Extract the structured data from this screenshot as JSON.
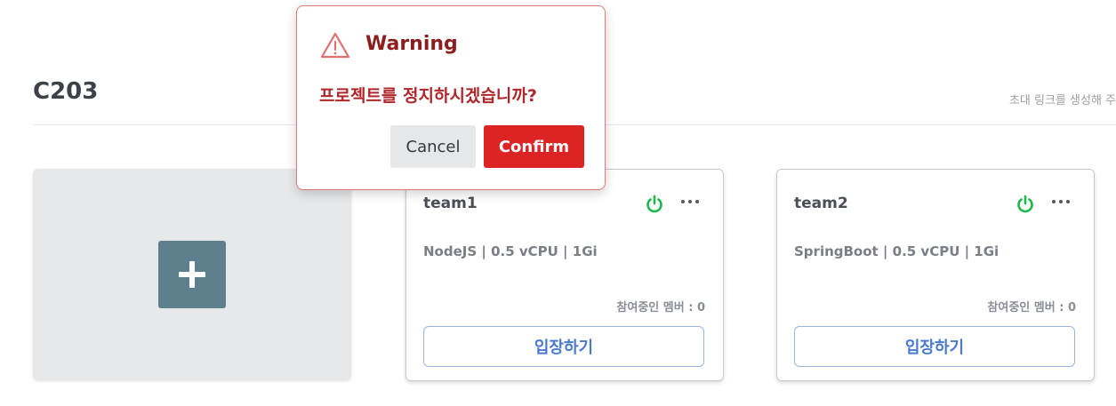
{
  "project": {
    "title": "C203",
    "invite_link_text": "초대 링크를 생성해 주"
  },
  "add_card": {
    "icon": "plus-icon",
    "background": "#e6e8ea",
    "button_color": "#5e7f8d"
  },
  "teams": [
    {
      "name": "team1",
      "spec": "NodeJS | 0.5 vCPU | 1Gi",
      "members_label": "참여중인 멤버 : 0",
      "enter_label": "입장하기",
      "status_icon": "power-icon",
      "status_color": "#1cb84a",
      "menu_icon": "more-horizontal-icon"
    },
    {
      "name": "team2",
      "spec": "SpringBoot | 0.5 vCPU | 1Gi",
      "members_label": "참여중인 멤버 : 0",
      "enter_label": "입장하기",
      "status_icon": "power-icon",
      "status_color": "#1cb84a",
      "menu_icon": "more-horizontal-icon"
    }
  ],
  "modal": {
    "icon": "warning-icon",
    "title": "Warning",
    "message": "프로젝트를 정지하시겠습니까?",
    "cancel_label": "Cancel",
    "confirm_label": "Confirm",
    "title_color": "#8e1e1e",
    "message_color": "#b0262b",
    "confirm_color": "#dc2424"
  }
}
